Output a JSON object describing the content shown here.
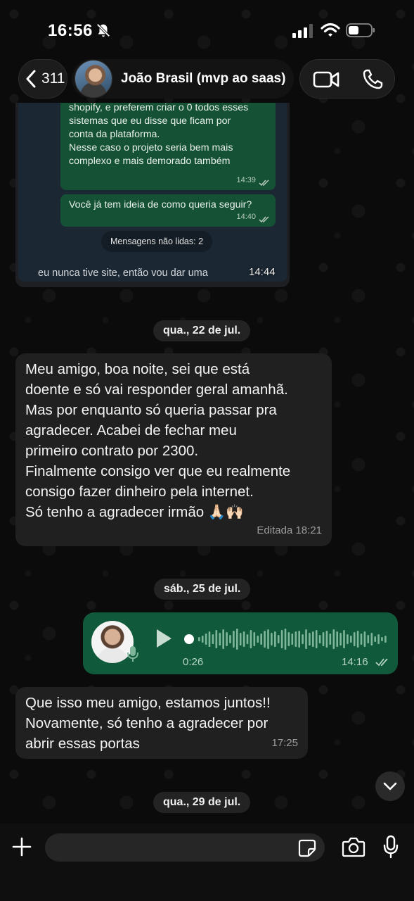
{
  "status_bar": {
    "time": "16:56"
  },
  "header": {
    "back_count": "311",
    "contact_name": "João Brasil (mvp ao saas)"
  },
  "screenshot_message": {
    "bubble1_lines": [
      "shopify, e preferem criar o 0 todos esses",
      "sistemas que eu disse que ficam por",
      "conta da plataforma.",
      "Nesse caso o projeto seria bem mais",
      "complexo e mais demorado também"
    ],
    "bubble1_time": "14:39",
    "bubble2_text": "Você já tem ideia de como queria seguir?",
    "bubble2_time": "14:40",
    "unread_label": "Mensagens não lidas: 2",
    "bottom_text": "eu nunca tive site, então vou dar uma",
    "time": "14:44"
  },
  "messages": {
    "date1": "qua., 22 de jul.",
    "msg1_lines": [
      "Meu amigo, boa noite, sei que está",
      "doente e só vai responder geral amanhã.",
      "Mas por enquanto só queria passar pra",
      "agradecer. Acabei de fechar meu",
      "primeiro contrato por 2300.",
      "Finalmente consigo ver que eu realmente",
      "consigo fazer dinheiro pela internet.",
      "Só tenho a agradecer irmão 🙏🏻🙌🏻"
    ],
    "msg1_meta": "Editada 18:21",
    "date2": "sáb., 25 de jul.",
    "voice_duration": "0:26",
    "voice_time": "14:16",
    "msg2_lines": [
      "Que isso meu amigo, estamos juntos!!",
      "Novamente, só tenho a agradecer por",
      "abrir essas portas"
    ],
    "msg2_time": "17:25",
    "date3": "qua., 29 de jul."
  },
  "input": {
    "placeholder": ""
  },
  "colors": {
    "outgoing_bubble": "#105a3b",
    "incoming_bubble": "#202020",
    "background": "#0b0b0b",
    "read_ticks": "#b7d4c4"
  },
  "icons": [
    "bell-slash-icon",
    "signal-icon",
    "wifi-icon",
    "battery-icon",
    "chevron-left-icon",
    "video-camera-icon",
    "phone-icon",
    "play-icon",
    "mic-icon",
    "chevron-down-icon",
    "plus-icon",
    "sticker-icon",
    "camera-icon"
  ]
}
